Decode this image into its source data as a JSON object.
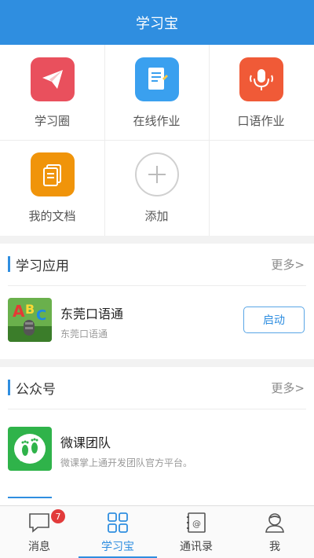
{
  "header": {
    "title": "学习宝"
  },
  "grid": {
    "items": [
      {
        "label": "学习圈",
        "icon": "paper-plane-icon",
        "color": "#e9505d"
      },
      {
        "label": "在线作业",
        "icon": "document-pen-icon",
        "color": "#3aa0ef"
      },
      {
        "label": "口语作业",
        "icon": "microphone-icon",
        "color": "#f05a37"
      },
      {
        "label": "我的文档",
        "icon": "documents-icon",
        "color": "#f0940a"
      },
      {
        "label": "添加",
        "icon": "add-icon",
        "color": "#cccccc"
      }
    ]
  },
  "apps": {
    "title": "学习应用",
    "more": "更多>",
    "items": [
      {
        "name": "东莞口语通",
        "desc": "东莞口语通",
        "button": "启动"
      }
    ]
  },
  "official": {
    "title": "公众号",
    "more": "更多>",
    "items": [
      {
        "name": "微课团队",
        "desc": "微课掌上通开发团队官方平台。"
      }
    ]
  },
  "tabbar": {
    "tabs": [
      {
        "label": "消息",
        "icon": "chat-bubble-icon",
        "badge": "7"
      },
      {
        "label": "学习宝",
        "icon": "grid-icon",
        "active": true
      },
      {
        "label": "通讯录",
        "icon": "contacts-icon"
      },
      {
        "label": "我",
        "icon": "person-icon"
      }
    ]
  },
  "colors": {
    "accent": "#2f8ee0",
    "badge": "#e23b3b"
  }
}
